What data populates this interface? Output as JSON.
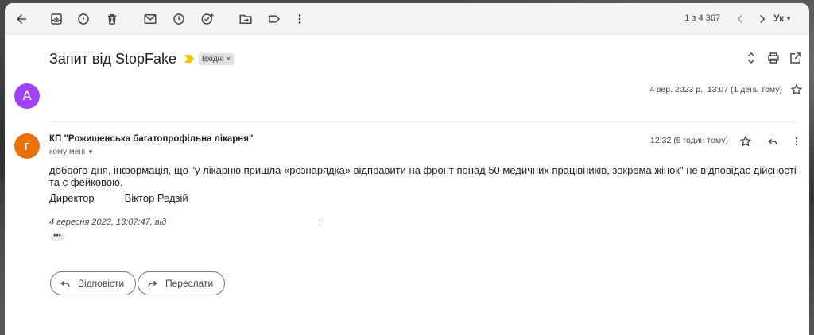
{
  "toolbar": {
    "icons": [
      "back-arrow-icon",
      "archive-icon",
      "report-spam-icon",
      "delete-icon",
      "mark-unread-icon",
      "snooze-icon",
      "add-to-tasks-icon",
      "move-to-icon",
      "label-icon",
      "more-icon"
    ],
    "count": "1 з 4 367",
    "lang": "Ук"
  },
  "email": {
    "subject": "Запит від StopFake",
    "label": "Вхідні",
    "label_close": "×"
  },
  "message1": {
    "avatar_letter": "A",
    "avatar_color": "#a142f4",
    "date": "4 вер. 2023 р., 13:07 (1 день тому)"
  },
  "message2": {
    "avatar_letter": "г",
    "avatar_color": "#e8710a",
    "sender": "КП \"Рожищенська багатопрофільна лікарня\"",
    "to": "кому мені",
    "time": "12:32 (5 годин тому)",
    "body": "доброго дня, інформація, що  \"у лікарню пришла «рознарядка» відправити на фронт понад 50 медичних працівників, зокрема жінок\" не відповідає дійсності та є фейковою.",
    "signature_title": "Директор",
    "signature_name": "Віктор Редзій",
    "quote": "4 вересня 2023, 13:07:47, від",
    "quote_colon": ":",
    "ellipsis": "•••"
  },
  "actions": {
    "reply": "Відповісти",
    "forward": "Переслати"
  },
  "colors": {
    "importance_marker": "#f4c20d",
    "toolbar_bg": "#f1f3f4"
  }
}
